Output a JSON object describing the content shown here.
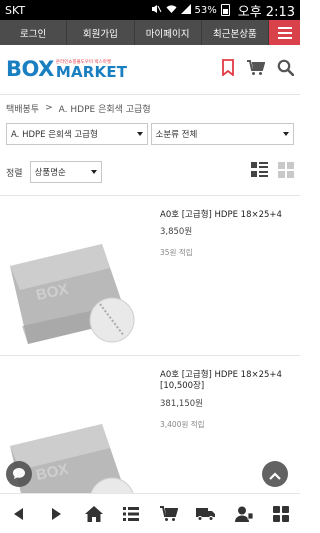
{
  "status": {
    "carrier": "SKT",
    "battery": "53%",
    "time": "오후 2:13"
  },
  "topnav": {
    "items": [
      "로그인",
      "회원가입",
      "마이페이지",
      "최근본상품"
    ],
    "menu_icon": "hamburger-icon",
    "menu_color": "#d9424a"
  },
  "header": {
    "logo_box": "BOX",
    "logo_market": "MARKET",
    "logo_tagline": "온라인쇼핑몰도우미 박스마켓",
    "icons": [
      "bookmark-icon",
      "cart-icon",
      "search-icon"
    ]
  },
  "breadcrumb": {
    "root": "택배봉투",
    "sep": ">",
    "current": "A. HDPE 은회색 고급형"
  },
  "filters": {
    "category": "A. HDPE 은회색 고급형",
    "subcategory": "소분류 전체"
  },
  "sort": {
    "label": "정렬",
    "value": "상품명순"
  },
  "products": [
    {
      "name": "A0호 [고급형] HDPE 18×25+4",
      "price": "3,850원",
      "points": "35원 적립"
    },
    {
      "name": "A0호 [고급형] HDPE 18×25+4 [10,500장]",
      "price": "381,150원",
      "points": "3,400원 적립"
    }
  ],
  "bottomnav": {
    "icons": [
      "back-icon",
      "forward-icon",
      "home-icon",
      "list-icon",
      "cart-icon",
      "delivery-truck-icon",
      "my-page-icon",
      "grid-icon"
    ]
  },
  "colors": {
    "brand_blue": "#1a7fc1",
    "brand_red": "#e23b45",
    "topnav_bg": "#4c4c4c"
  }
}
